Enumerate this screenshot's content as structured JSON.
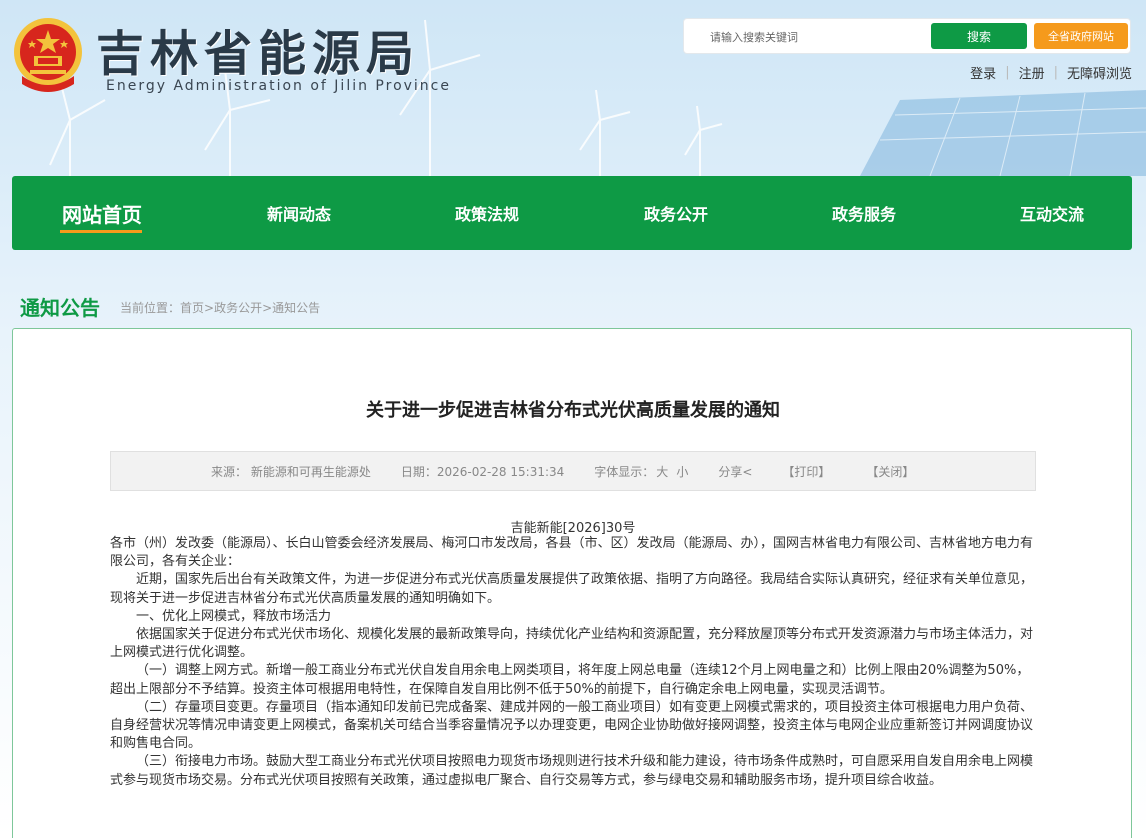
{
  "header": {
    "title": "吉林省能源局",
    "subtitle": "Energy Administration of Jilin Province",
    "search_placeholder": "请输入搜索关键词",
    "search_button": "搜索",
    "province_button": "全省政府网站",
    "links": [
      "登录",
      "注册",
      "无障碍浏览"
    ]
  },
  "nav": {
    "items": [
      "网站首页",
      "新闻动态",
      "政策法规",
      "政务公开",
      "政务服务",
      "互动交流"
    ],
    "active_index": 0
  },
  "section": {
    "title": "通知公告",
    "breadcrumb": {
      "prefix": "当前位置：",
      "items": [
        "首页",
        "政务公开",
        "通知公告"
      ],
      "separator": ">"
    }
  },
  "article": {
    "title": "关于进一步促进吉林省分布式光伏高质量发展的通知",
    "meta": {
      "source": "来源： 新能源和可再生能源处",
      "date": "日期：2026-02-28 15:31:34",
      "font_label": "字体显示：",
      "font_large": "大",
      "font_small": "小",
      "share": "分享",
      "print": "【打印】",
      "close": "【关闭】"
    },
    "doc_number": "吉能新能[2026]30号",
    "paragraphs": [
      "各市（州）发改委（能源局）、长白山管委会经济发展局、梅河口市发改局，各县（市、区）发改局（能源局、办），国网吉林省电力有限公司、吉林省地方电力有限公司，各有关企业：",
      "近期，国家先后出台有关政策文件，为进一步促进分布式光伏高质量发展提供了政策依据、指明了方向路径。我局结合实际认真研究，经征求有关单位意见，现将关于进一步促进吉林省分布式光伏高质量发展的通知明确如下。",
      "一、优化上网模式，释放市场活力",
      "依据国家关于促进分布式光伏市场化、规模化发展的最新政策导向，持续优化产业结构和资源配置，充分释放屋顶等分布式开发资源潜力与市场主体活力，对上网模式进行优化调整。",
      "（一）调整上网方式。新增一般工商业分布式光伏自发自用余电上网类项目，将年度上网总电量（连续12个月上网电量之和）比例上限由20%调整为50%，超出上限部分不予结算。投资主体可根据用电特性，在保障自发自用比例不低于50%的前提下，自行确定余电上网电量，实现灵活调节。",
      "（二）存量项目变更。存量项目（指本通知印发前已完成备案、建成并网的一般工商业项目）如有变更上网模式需求的，项目投资主体可根据电力用户负荷、自身经营状况等情况申请变更上网模式，备案机关可结合当季容量情况予以办理变更，电网企业协助做好接网调整，投资主体与电网企业应重新签订并网调度协议和购售电合同。",
      "（三）衔接电力市场。鼓励大型工商业分布式光伏项目按照电力现货市场规则进行技术升级和能力建设，待市场条件成熟时，可自愿采用自发自用余电上网模式参与现货市场交易。分布式光伏项目按照有关政策，通过虚拟电厂聚合、自行交易等方式，参与绿电交易和辅助服务市场，提升项目综合收益。"
    ]
  },
  "colors": {
    "brand_green": "#0e9a45",
    "accent_orange": "#f59a1c",
    "emblem_red": "#d7261d",
    "emblem_gold": "#f3c33c"
  }
}
